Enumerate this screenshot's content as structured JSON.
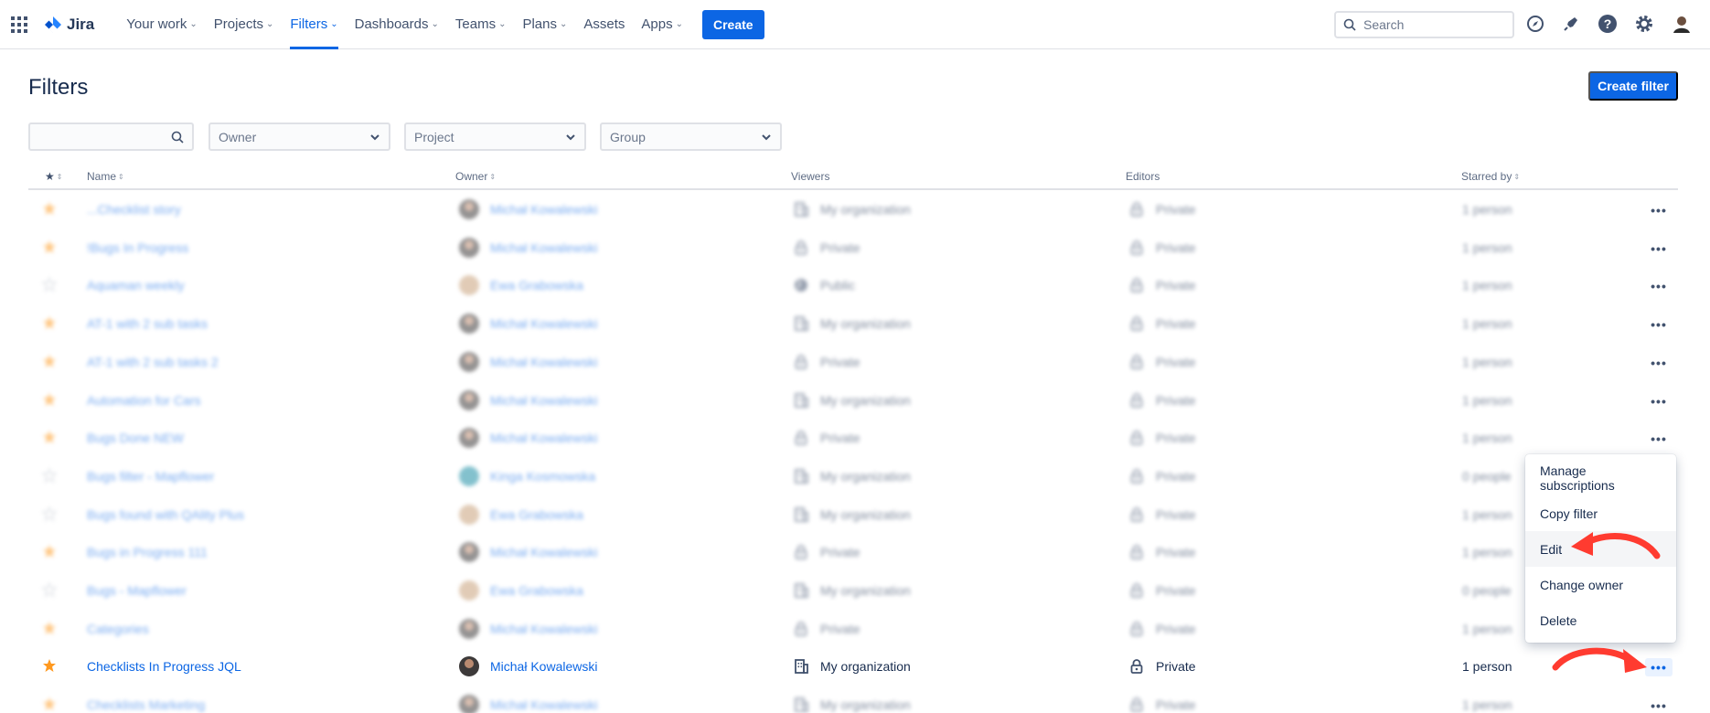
{
  "topnav": {
    "logo_text": "Jira",
    "items": [
      {
        "label": "Your work",
        "has_chevron": true,
        "active": false
      },
      {
        "label": "Projects",
        "has_chevron": true,
        "active": false
      },
      {
        "label": "Filters",
        "has_chevron": true,
        "active": true
      },
      {
        "label": "Dashboards",
        "has_chevron": true,
        "active": false
      },
      {
        "label": "Teams",
        "has_chevron": true,
        "active": false
      },
      {
        "label": "Plans",
        "has_chevron": true,
        "active": false
      },
      {
        "label": "Assets",
        "has_chevron": false,
        "active": false
      },
      {
        "label": "Apps",
        "has_chevron": true,
        "active": false
      }
    ],
    "create_label": "Create",
    "search_placeholder": "Search",
    "icons": [
      "compass-icon",
      "notifications-icon",
      "help-icon",
      "settings-icon",
      "profile-avatar"
    ]
  },
  "page": {
    "title": "Filters",
    "create_filter_label": "Create filter"
  },
  "filters": {
    "search_value": "",
    "owner_placeholder": "Owner",
    "project_placeholder": "Project",
    "group_placeholder": "Group"
  },
  "table": {
    "headers": {
      "name": "Name",
      "owner": "Owner",
      "viewers": "Viewers",
      "editors": "Editors",
      "starred_by": "Starred by"
    },
    "rows": [
      {
        "starred": true,
        "name": "...Checklist story",
        "owner": "Michał Kowalewski",
        "avatar": "dark",
        "viewers": "My organization",
        "viewers_icon": "org",
        "editors": "Private",
        "starred_by": "1 person",
        "blurred": true
      },
      {
        "starred": true,
        "name": "!Bugs In Progress",
        "owner": "Michał Kowalewski",
        "avatar": "dark",
        "viewers": "Private",
        "viewers_icon": "lock",
        "editors": "Private",
        "starred_by": "1 person",
        "blurred": true
      },
      {
        "starred": false,
        "name": "Aquaman weekly",
        "owner": "Ewa Grabowska",
        "avatar": "tan",
        "viewers": "Public",
        "viewers_icon": "globe",
        "editors": "Private",
        "starred_by": "1 person",
        "blurred": true
      },
      {
        "starred": true,
        "name": "AT-1 with 2 sub tasks",
        "owner": "Michał Kowalewski",
        "avatar": "dark",
        "viewers": "My organization",
        "viewers_icon": "org",
        "editors": "Private",
        "starred_by": "1 person",
        "blurred": true
      },
      {
        "starred": true,
        "name": "AT-1 with 2 sub tasks 2",
        "owner": "Michał Kowalewski",
        "avatar": "dark",
        "viewers": "Private",
        "viewers_icon": "lock",
        "editors": "Private",
        "starred_by": "1 person",
        "blurred": true
      },
      {
        "starred": true,
        "name": "Automation for Cars",
        "owner": "Michał Kowalewski",
        "avatar": "dark",
        "viewers": "My organization",
        "viewers_icon": "org",
        "editors": "Private",
        "starred_by": "1 person",
        "blurred": true
      },
      {
        "starred": true,
        "name": "Bugs Done NEW",
        "owner": "Michał Kowalewski",
        "avatar": "dark",
        "viewers": "Private",
        "viewers_icon": "lock",
        "editors": "Private",
        "starred_by": "1 person",
        "blurred": true
      },
      {
        "starred": false,
        "name": "Bugs filter - Mapflower",
        "owner": "Kinga Kosmowska",
        "avatar": "teal",
        "viewers": "My organization",
        "viewers_icon": "org",
        "editors": "Private",
        "starred_by": "0 people",
        "blurred": true
      },
      {
        "starred": false,
        "name": "Bugs found with QAlity Plus",
        "owner": "Ewa Grabowska",
        "avatar": "tan",
        "viewers": "My organization",
        "viewers_icon": "org",
        "editors": "Private",
        "starred_by": "1 person",
        "blurred": true
      },
      {
        "starred": true,
        "name": "Bugs in Progress 111",
        "owner": "Michał Kowalewski",
        "avatar": "dark",
        "viewers": "Private",
        "viewers_icon": "lock",
        "editors": "Private",
        "starred_by": "1 person",
        "blurred": true
      },
      {
        "starred": false,
        "name": "Bugs - Mapflower",
        "owner": "Ewa Grabowska",
        "avatar": "tan",
        "viewers": "My organization",
        "viewers_icon": "org",
        "editors": "Private",
        "starred_by": "0 people",
        "blurred": true
      },
      {
        "starred": true,
        "name": "Categories",
        "owner": "Michał Kowalewski",
        "avatar": "dark",
        "viewers": "Private",
        "viewers_icon": "lock",
        "editors": "Private",
        "starred_by": "1 person",
        "blurred": true
      },
      {
        "starred": true,
        "name": "Checklists In Progress JQL",
        "owner": "Michał Kowalewski",
        "avatar": "dark",
        "viewers": "My organization",
        "viewers_icon": "org",
        "editors": "Private",
        "starred_by": "1 person",
        "blurred": false,
        "menu_open": true
      },
      {
        "starred": true,
        "name": "Checklists Marketing",
        "owner": "Michał Kowalewski",
        "avatar": "dark",
        "viewers": "My organization",
        "viewers_icon": "org",
        "editors": "Private",
        "starred_by": "1 person",
        "blurred": true
      }
    ]
  },
  "menu": {
    "items": [
      {
        "label": "Manage subscriptions",
        "hover": false
      },
      {
        "label": "Copy filter",
        "hover": false
      },
      {
        "label": "Edit",
        "hover": true
      },
      {
        "label": "Change owner",
        "hover": false
      },
      {
        "label": "Delete",
        "hover": false
      }
    ]
  },
  "colors": {
    "brand": "#0c66e4",
    "star": "#ff991f",
    "annotation": "#ff3b30"
  }
}
